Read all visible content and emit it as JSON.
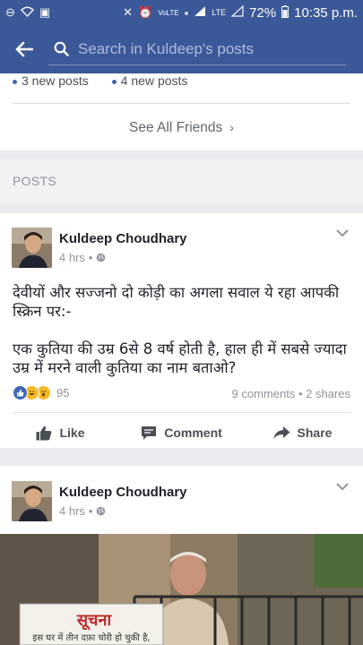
{
  "status": {
    "battery": "72%",
    "time": "10:35 p.m.",
    "network": "LTE"
  },
  "search": {
    "placeholder": "Search in Kuldeep's posts"
  },
  "friends": {
    "new_posts": [
      "3 new posts",
      "4 new posts"
    ],
    "see_all": "See All Friends"
  },
  "section": {
    "posts_label": "POSTS"
  },
  "posts": [
    {
      "author": "Kuldeep Choudhary",
      "time": "4 hrs",
      "text_line1": "देवीयों और सज्जनो दो कोड़ी का अगला सवाल ये रहा आपकी स्क्रिन पर:-",
      "text_line2": "एक कुतिया की उम्र 6से 8 वर्ष होती है, हाल ही में सबसे ज्यादा उम्र में मरने वाली कुतिया का नाम बताओ?",
      "reaction_count": "95",
      "comments": "9 comments",
      "shares": "2 shares",
      "actions": {
        "like": "Like",
        "comment": "Comment",
        "share": "Share"
      }
    },
    {
      "author": "Kuldeep Choudhary",
      "time": "4 hrs",
      "photo_sign_title": "सूचना",
      "photo_sign_text": "इस घर में तीन दफ़ा चोरी हो चुकी है,"
    }
  ],
  "colors": {
    "brand": "#3b5998",
    "like_blue": "#4267b2",
    "haha_yellow": "#f7b928"
  }
}
